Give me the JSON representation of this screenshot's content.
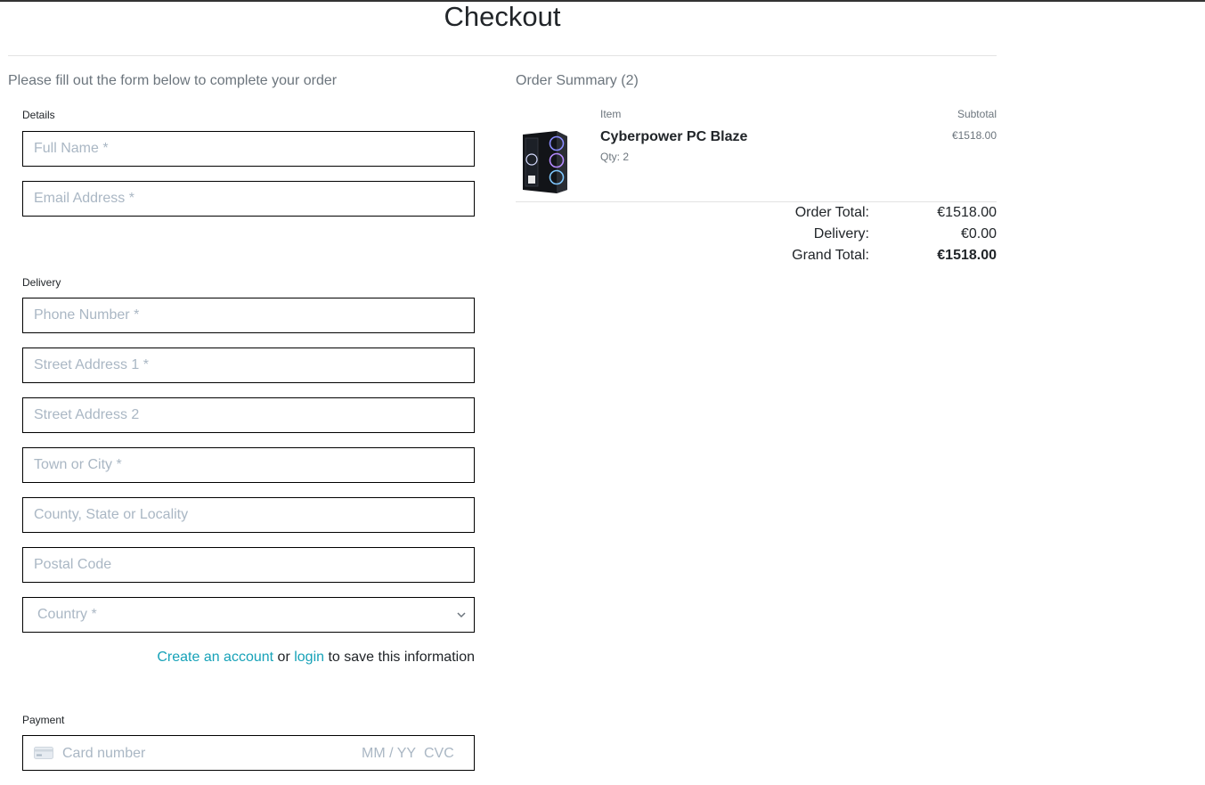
{
  "page": {
    "title": "Checkout"
  },
  "form": {
    "intro": "Please fill out the form below to complete your order",
    "details_legend": "Details",
    "full_name_placeholder": "Full Name *",
    "email_placeholder": "Email Address *",
    "delivery_legend": "Delivery",
    "phone_placeholder": "Phone Number *",
    "street1_placeholder": "Street Address 1 *",
    "street2_placeholder": "Street Address 2",
    "town_placeholder": "Town or City *",
    "county_placeholder": "County, State or Locality",
    "postcode_placeholder": "Postal Code",
    "country_selected": "Country *",
    "save_info": {
      "create_link": "Create an account",
      "or_text": " or ",
      "login_link": "login",
      "suffix": " to save this information"
    },
    "payment_legend": "Payment",
    "card": {
      "number_placeholder": "Card number",
      "expiry_placeholder": "MM / YY",
      "cvc_placeholder": "CVC",
      "icon": "credit-card-icon"
    }
  },
  "summary": {
    "title": "Order Summary (2)",
    "col_item": "Item",
    "col_subtotal": "Subtotal",
    "items": [
      {
        "name": "Cyberpower PC Blaze",
        "qty": "Qty: 2",
        "subtotal": "€1518.00",
        "image": "pc-case-image"
      }
    ],
    "order_total_label": "Order Total:",
    "order_total_value": "€1518.00",
    "delivery_label": "Delivery:",
    "delivery_value": "€0.00",
    "grand_total_label": "Grand Total:",
    "grand_total_value": "€1518.00"
  },
  "colors": {
    "link": "#17a2b8",
    "muted": "#6c757d",
    "placeholder": "#aab7c4",
    "border": "#000000"
  }
}
